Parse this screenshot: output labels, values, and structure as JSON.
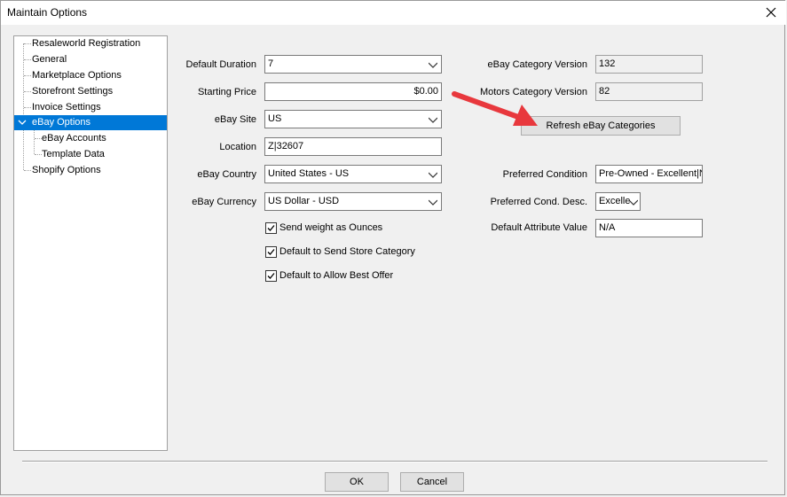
{
  "window": {
    "title": "Maintain Options"
  },
  "tree": {
    "items": [
      {
        "label": "Resaleworld Registration"
      },
      {
        "label": "General"
      },
      {
        "label": "Marketplace Options"
      },
      {
        "label": "Storefront Settings"
      },
      {
        "label": "Invoice Settings"
      },
      {
        "label": "eBay Options",
        "selected": true
      },
      {
        "label": "eBay Accounts"
      },
      {
        "label": "Template Data"
      },
      {
        "label": "Shopify Options"
      }
    ]
  },
  "form": {
    "default_duration": {
      "label": "Default Duration",
      "value": "7"
    },
    "starting_price": {
      "label": "Starting Price",
      "value": "$0.00"
    },
    "ebay_site": {
      "label": "eBay Site",
      "value": "US"
    },
    "location": {
      "label": "Location",
      "value": "Z|32607"
    },
    "ebay_country": {
      "label": "eBay Country",
      "value": "United States - US"
    },
    "ebay_currency": {
      "label": "eBay Currency",
      "value": "US Dollar - USD"
    },
    "send_weight": {
      "label": "Send weight as Ounces",
      "checked": true
    },
    "send_store_category": {
      "label": "Default to Send Store Category",
      "checked": true
    },
    "allow_best_offer": {
      "label": "Default to Allow Best Offer",
      "checked": true
    },
    "category_version": {
      "label": "eBay Category Version",
      "value": "132"
    },
    "motors_category_version": {
      "label": "Motors Category Version",
      "value": "82"
    },
    "refresh_button": {
      "label": "Refresh eBay Categories"
    },
    "preferred_condition": {
      "label": "Preferred Condition",
      "value": "Pre-Owned - Excellent|N"
    },
    "preferred_cond_desc": {
      "label": "Preferred Cond. Desc.",
      "value": "Excelle"
    },
    "default_attribute_value": {
      "label": "Default Attribute Value",
      "value": "N/A"
    }
  },
  "buttons": {
    "ok": "OK",
    "cancel": "Cancel"
  },
  "colors": {
    "selection": "#0078d7",
    "annotation_arrow": "#e8383d"
  }
}
